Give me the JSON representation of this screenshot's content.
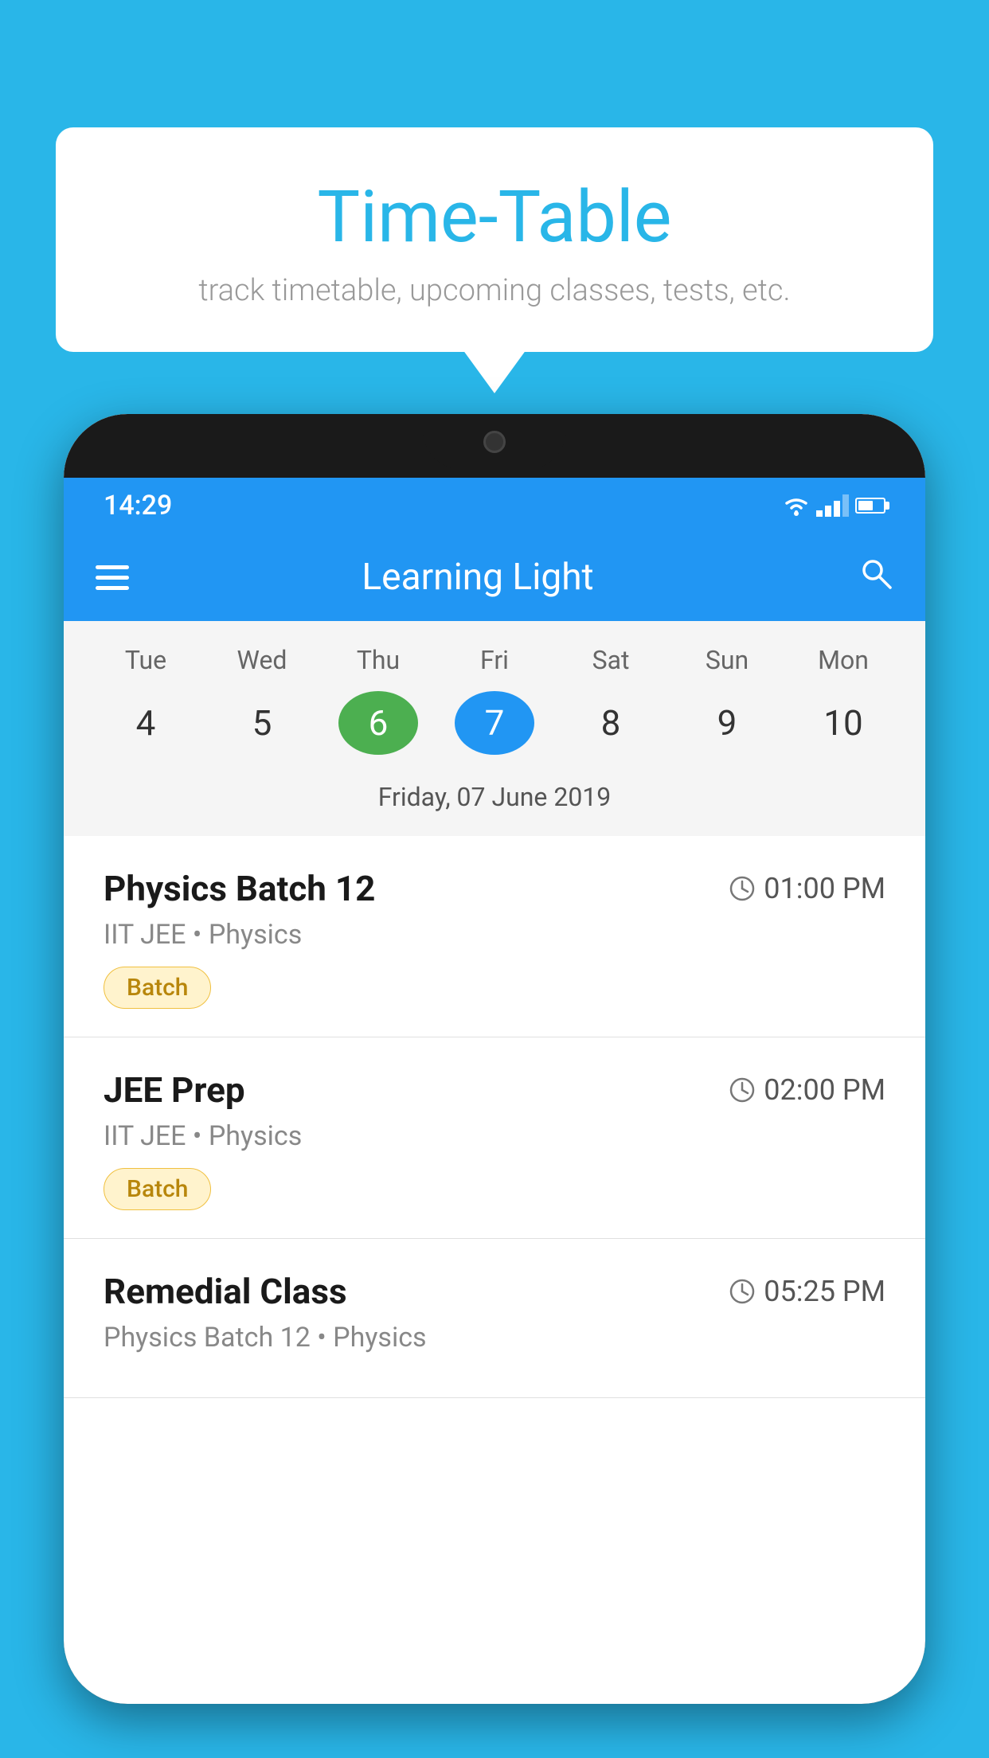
{
  "background": {
    "color": "#29b6e8"
  },
  "speech_bubble": {
    "title": "Time-Table",
    "subtitle": "track timetable, upcoming classes, tests, etc."
  },
  "phone": {
    "status_bar": {
      "time": "14:29"
    },
    "app_bar": {
      "title": "Learning Light"
    },
    "calendar": {
      "days_of_week": [
        "Tue",
        "Wed",
        "Thu",
        "Fri",
        "Sat",
        "Sun",
        "Mon"
      ],
      "dates": [
        "4",
        "5",
        "6",
        "7",
        "8",
        "9",
        "10"
      ],
      "today_index": 2,
      "selected_index": 3,
      "date_label": "Friday, 07 June 2019"
    },
    "classes": [
      {
        "name": "Physics Batch 12",
        "time": "01:00 PM",
        "subject": "IIT JEE • Physics",
        "badge": "Batch"
      },
      {
        "name": "JEE Prep",
        "time": "02:00 PM",
        "subject": "IIT JEE • Physics",
        "badge": "Batch"
      },
      {
        "name": "Remedial Class",
        "time": "05:25 PM",
        "subject": "Physics Batch 12 • Physics",
        "badge": ""
      }
    ]
  }
}
